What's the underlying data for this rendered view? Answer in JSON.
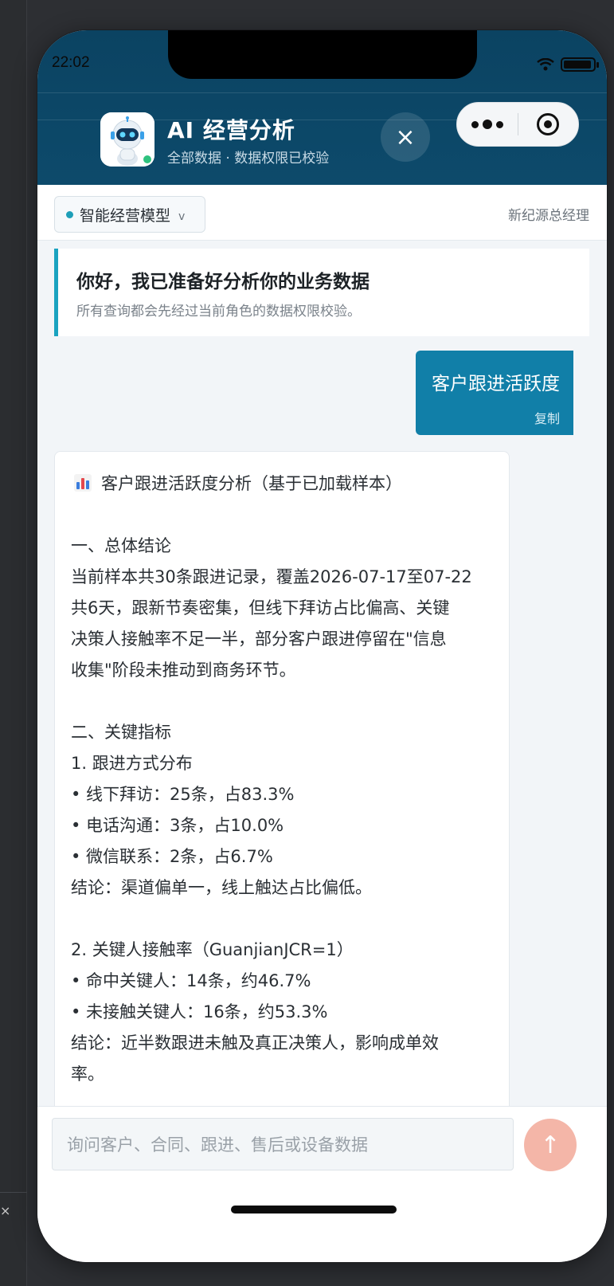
{
  "status_bar": {
    "time": "22:02"
  },
  "header": {
    "title": "AI 经营分析",
    "subtitle": "全部数据 · 数据权限已校验",
    "close_icon": "×"
  },
  "subbar": {
    "model_label": "智能经营模型",
    "model_chevron": "v",
    "role": "新纪源总经理"
  },
  "welcome": {
    "title": "你好，我已准备好分析你的业务数据",
    "subtitle": "所有查询都会先经过当前角色的数据权限校验。"
  },
  "user_message": {
    "text": "客户跟进活跃度",
    "copy_label": "复制"
  },
  "answer": {
    "heading": "客户跟进活跃度分析（基于已加载样本）",
    "lines": [
      "一、总体结论",
      "当前样本共30条跟进记录，覆盖2026-07-17至07-22",
      "共6天，跟新节奏密集，但线下拜访占比偏高、关键",
      "决策人接触率不足一半，部分客户跟进停留在\"信息",
      "收集\"阶段未推动到商务环节。",
      "二、关键指标",
      "1. 跟进方式分布",
      "• 线下拜访：25条，占83.3%",
      "• 电话沟通：3条，占10.0%",
      "• 微信联系：2条，占6.7%",
      "结论：渠道偏单一，线上触达占比偏低。",
      "2. 关键人接触率（GuanjianJCR=1）",
      "• 命中关键人：14条，约46.7%",
      "• 未接触关键人：16条，约53.3%",
      "结论：近半数跟进未触及真正决策人，影响成单效",
      "率。"
    ]
  },
  "input": {
    "placeholder": "询问客户、合同、跟进、售后或设备数据",
    "send_icon": "↑"
  },
  "colors": {
    "header_bg": "#0b4362",
    "accent": "#1aa3c0",
    "user_bubble": "#117fa8",
    "send_button": "#f4b6a8",
    "online": "#2ec27e"
  },
  "icons": [
    "robot-avatar-icon",
    "close-icon",
    "more-icon",
    "target-icon",
    "chevron-down-icon",
    "bar-chart-icon",
    "arrow-up-icon",
    "wifi-icon",
    "battery-icon"
  ]
}
